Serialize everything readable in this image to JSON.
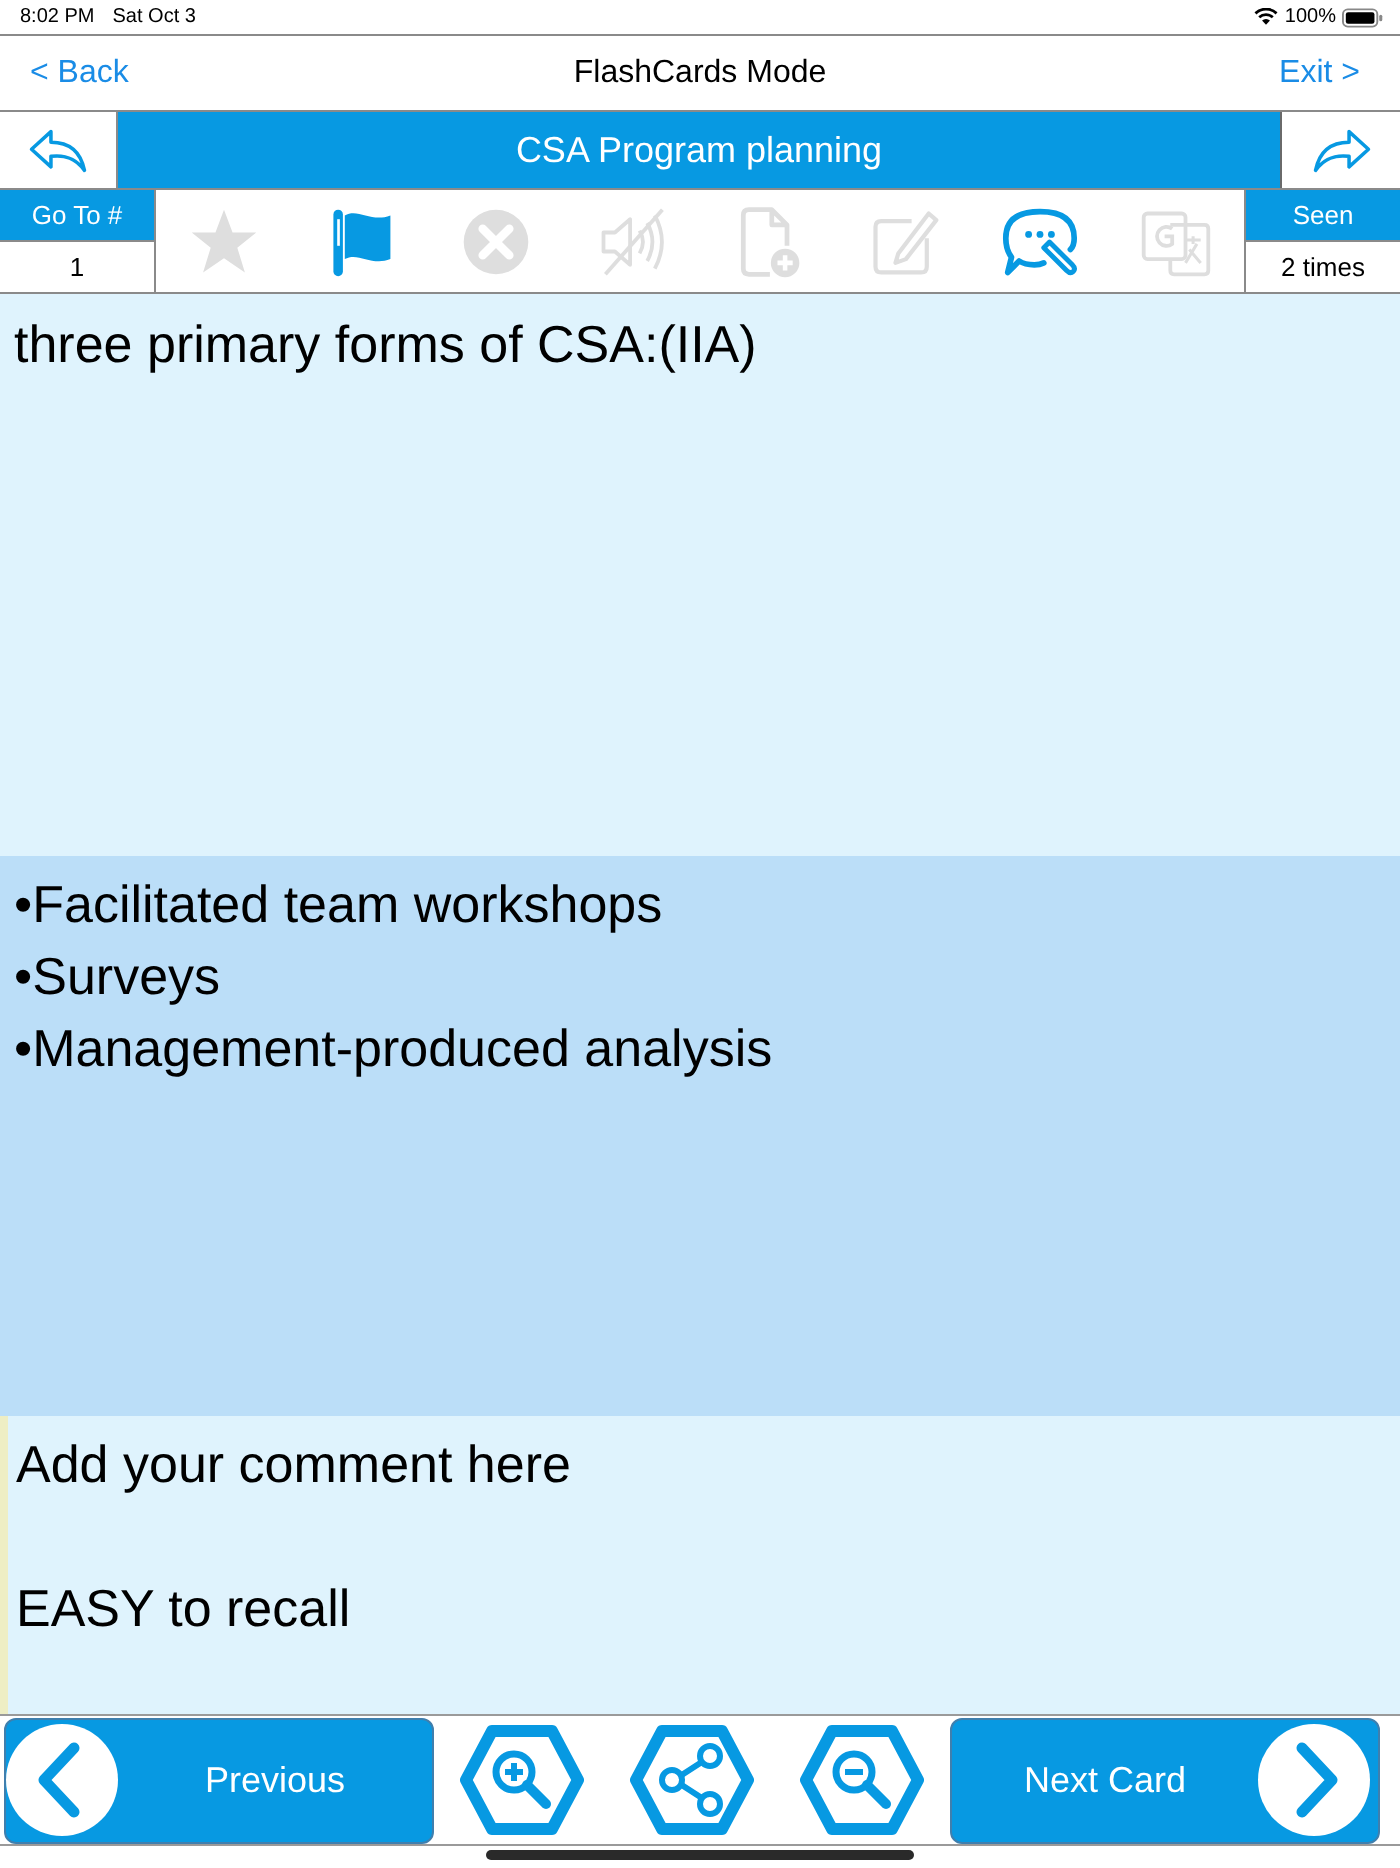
{
  "status_bar": {
    "time": "8:02 PM",
    "date": "Sat Oct 3",
    "battery": "100%"
  },
  "nav_bar": {
    "back": "< Back",
    "title": "FlashCards Mode",
    "exit": "Exit >"
  },
  "deck_bar": {
    "title": "CSA Program planning"
  },
  "toolbar": {
    "go_to": {
      "label": "Go To #",
      "value": "1"
    },
    "icons": [
      {
        "kind": "star",
        "on": false
      },
      {
        "kind": "flag",
        "on": true
      },
      {
        "kind": "delete",
        "on": false
      },
      {
        "kind": "mute",
        "on": false
      },
      {
        "kind": "add_file",
        "on": false
      },
      {
        "kind": "edit",
        "on": false
      },
      {
        "kind": "comment",
        "on": true
      },
      {
        "kind": "translate",
        "on": false
      }
    ],
    "seen": {
      "label": "Seen",
      "value": "2 times"
    }
  },
  "question": "three primary forms of CSA:(IIA)",
  "answer": [
    "•Facilitated team workshops",
    "•Surveys",
    "•Management-produced analysis"
  ],
  "comment": [
    "Add your comment here",
    "EASY to recall"
  ],
  "bottom_bar": {
    "previous": "Previous",
    "tools": [
      {
        "kind": "zoom_in"
      },
      {
        "kind": "share"
      },
      {
        "kind": "zoom_out"
      }
    ],
    "next": "Next Card"
  }
}
